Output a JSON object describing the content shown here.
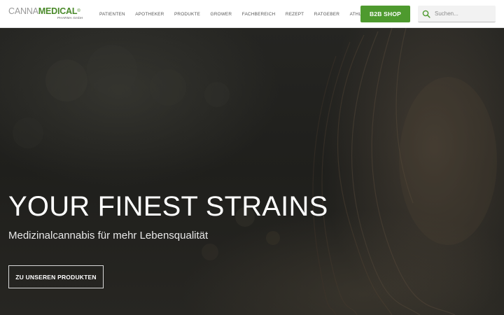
{
  "header": {
    "logo": {
      "canna": "CANNA",
      "medical": "MEDICAL",
      "registered": "®",
      "tagline": "PHARMA GmbH"
    },
    "nav": [
      {
        "label": "PATIENTEN"
      },
      {
        "label": "APOTHEKER"
      },
      {
        "label": "PRODUKTE"
      },
      {
        "label": "GROWER"
      },
      {
        "label": "FACHBEREICH"
      },
      {
        "label": "REZEPT"
      },
      {
        "label": "RATGEBER"
      },
      {
        "label": "ATHLETEN"
      }
    ],
    "b2b_label": "B2B SHOP",
    "search": {
      "placeholder": "Suchen...",
      "value": ""
    }
  },
  "hero": {
    "title": "YOUR FINEST STRAINS",
    "subtitle": "Medizinalcannabis für mehr Lebensqualität",
    "cta_label": "ZU UNSEREN PRODUKTEN"
  },
  "colors": {
    "brand_green": "#4e9a2e",
    "logo_grey": "#9a9a9a",
    "hero_overlay": "#1f1f1c"
  },
  "icons": {
    "search": "search-icon"
  }
}
